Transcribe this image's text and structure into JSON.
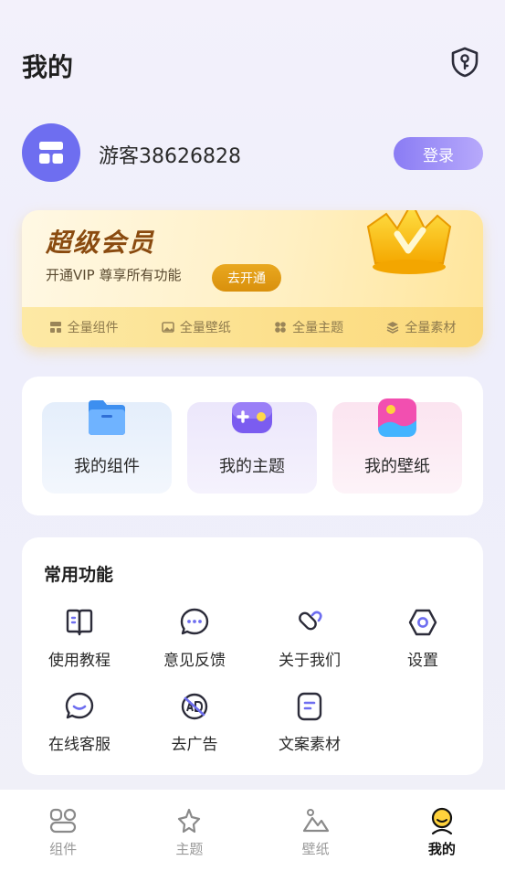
{
  "header": {
    "title": "我的"
  },
  "user": {
    "name": "游客38626828",
    "login_label": "登录"
  },
  "vip": {
    "title": "超级会员",
    "subtitle": "开通VIP  尊享所有功能",
    "open_label": "去开通",
    "features": [
      {
        "label": "全量组件",
        "icon": "widget-icon"
      },
      {
        "label": "全量壁纸",
        "icon": "image-icon"
      },
      {
        "label": "全量主题",
        "icon": "theme-icon"
      },
      {
        "label": "全量素材",
        "icon": "layers-icon"
      }
    ]
  },
  "mine": {
    "tiles": [
      {
        "label": "我的组件",
        "icon": "folder-icon"
      },
      {
        "label": "我的主题",
        "icon": "gamepad-icon"
      },
      {
        "label": "我的壁纸",
        "icon": "picture-icon"
      }
    ]
  },
  "functions": {
    "title": "常用功能",
    "items": [
      {
        "label": "使用教程",
        "icon": "book-icon"
      },
      {
        "label": "意见反馈",
        "icon": "chat-icon"
      },
      {
        "label": "关于我们",
        "icon": "about-icon"
      },
      {
        "label": "设置",
        "icon": "settings-icon"
      },
      {
        "label": "在线客服",
        "icon": "service-icon"
      },
      {
        "label": "去广告",
        "icon": "no-ad-icon"
      },
      {
        "label": "文案素材",
        "icon": "document-icon"
      }
    ]
  },
  "tabs": [
    {
      "label": "组件",
      "icon": "widgets-tab-icon"
    },
    {
      "label": "主题",
      "icon": "theme-tab-icon"
    },
    {
      "label": "壁纸",
      "icon": "wallpaper-tab-icon"
    },
    {
      "label": "我的",
      "icon": "me-tab-icon",
      "active": true
    }
  ],
  "colors": {
    "accent": "#6e6ef0",
    "vip_gold": "#e9a820",
    "icon_stroke": "#2c2c3a"
  }
}
